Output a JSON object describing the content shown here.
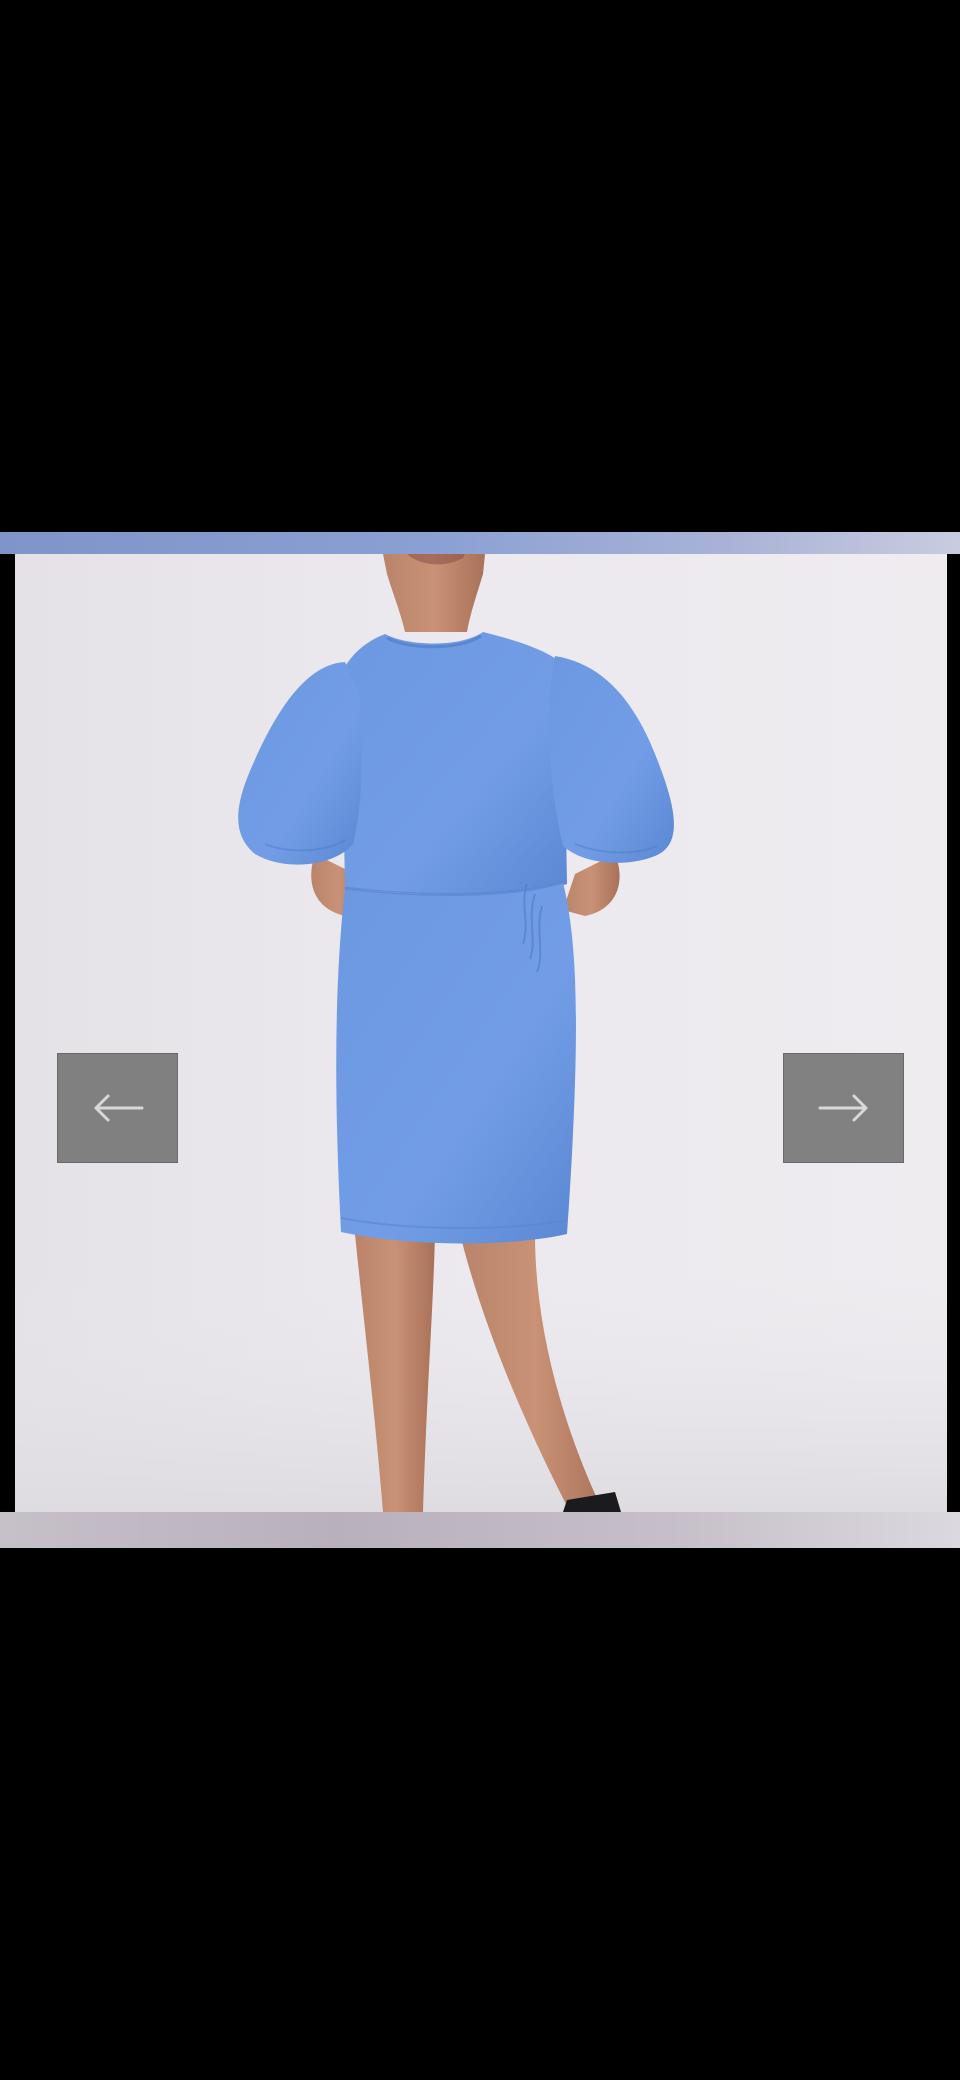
{
  "viewer": {
    "image": {
      "description_icon": "product-photo-blue-dress",
      "dress_color": "#6f9ae3"
    },
    "prev_button": {
      "icon": "arrow-left-icon"
    },
    "next_button": {
      "icon": "arrow-right-icon"
    }
  },
  "colors": {
    "background": "#000000",
    "top_band": "#8aa0d3",
    "bottom_band": "#c6c0c9",
    "nav_button": "#6e6e6e",
    "nav_arrow": "#d8d8d8"
  }
}
